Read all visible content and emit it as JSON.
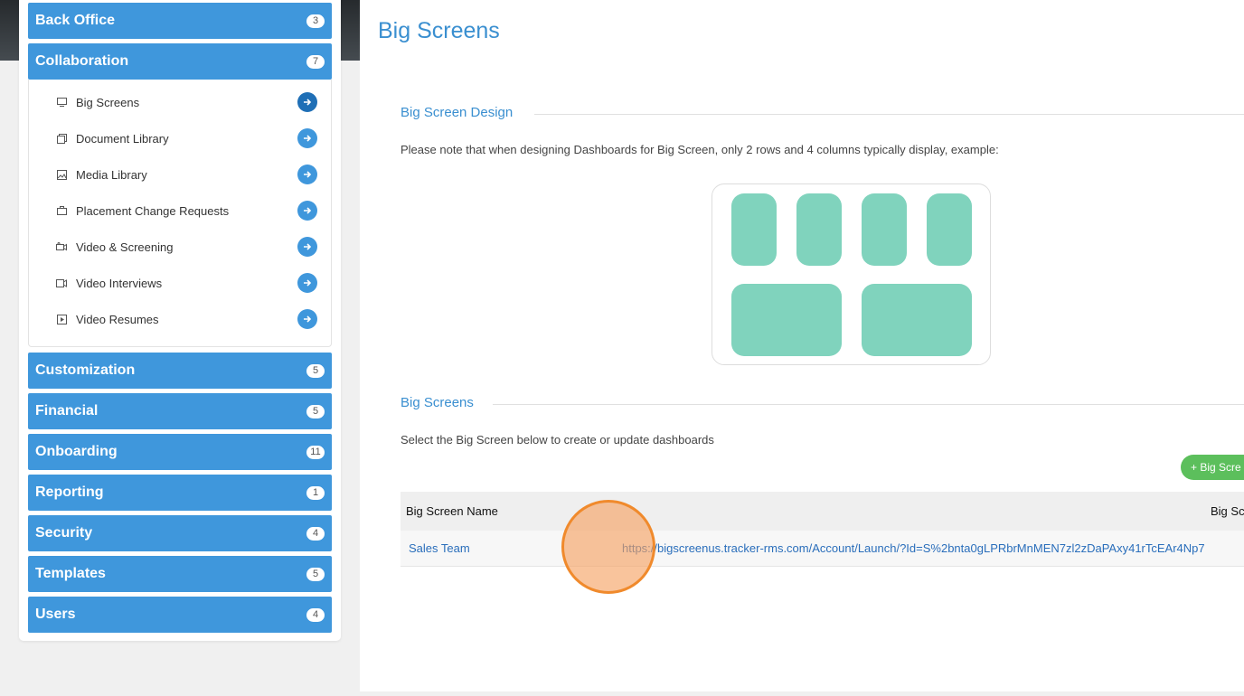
{
  "sidebar": {
    "categories": [
      {
        "label": "Back Office",
        "count": "3"
      },
      {
        "label": "Collaboration",
        "count": "7"
      },
      {
        "label": "Customization",
        "count": "5"
      },
      {
        "label": "Financial",
        "count": "5"
      },
      {
        "label": "Onboarding",
        "count": "11"
      },
      {
        "label": "Reporting",
        "count": "1"
      },
      {
        "label": "Security",
        "count": "4"
      },
      {
        "label": "Templates",
        "count": "5"
      },
      {
        "label": "Users",
        "count": "4"
      }
    ],
    "collaboration_items": [
      {
        "label": "Big Screens",
        "icon": "monitor-icon"
      },
      {
        "label": "Document Library",
        "icon": "documents-icon"
      },
      {
        "label": "Media Library",
        "icon": "image-icon"
      },
      {
        "label": "Placement Change Requests",
        "icon": "briefcase-icon"
      },
      {
        "label": "Video & Screening",
        "icon": "video-camera-icon"
      },
      {
        "label": "Video Interviews",
        "icon": "video-icon"
      },
      {
        "label": "Video Resumes",
        "icon": "play-icon"
      }
    ]
  },
  "main": {
    "title": "Big Screens",
    "design_section": {
      "title": "Big Screen Design",
      "note": "Please note that when designing Dashboards for Big Screen, only 2 rows and 4 columns typically display, example:"
    },
    "screens_section": {
      "title": "Big Screens",
      "note": "Select the Big Screen below to create or update dashboards",
      "add_button": "+ Big Scre"
    },
    "table": {
      "headers": [
        "Big Screen Name",
        "Big Sc"
      ],
      "rows": [
        {
          "name": "Sales Team",
          "url": "https://bigscreenus.tracker-rms.com/Account/Launch/?Id=S%2bnta0gLPRbrMnMEN7zl2zDaPAxy41rTcEAr4Np7"
        }
      ]
    }
  },
  "colors": {
    "accent": "#3f97dc",
    "tile": "#80d3bd",
    "add_button": "#5cbf5c",
    "click_marker": "#f08a2c"
  }
}
